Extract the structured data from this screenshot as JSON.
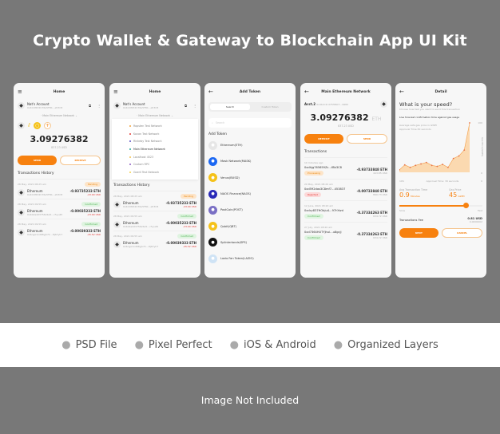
{
  "title": "Crypto Wallet & Gateway to Blockchain App UI Kit",
  "home": {
    "header": "Home",
    "account_name": "Nat's Account",
    "account_address": "0x4C4f432C76e5F8b…e53C8",
    "network": "Main Ethereum Network",
    "balance": "3.09276382",
    "balance_usd": "837.23 USD",
    "send": "SEND",
    "receive": "RECEIVE",
    "history_title": "Transactions History",
    "transactions": [
      {
        "date": "28 May, 2021 08:25 am",
        "status": "Pending",
        "name": "Ethereum",
        "address": "0x4C4f432C76e5F8b…e53C8",
        "amount": "-0.93735233 ETH",
        "usd": "-43.90 USD"
      },
      {
        "date": "28 May, 2021 09:55 am",
        "status": "Confirmed",
        "name": "Ethereum",
        "address": "0x4b2a4d375624a5…c5yu45",
        "amount": "-0.00035233 ETH",
        "usd": "-23.90 USD"
      },
      {
        "date": "28 May, 2021 09:55 am",
        "status": "Confirmed",
        "name": "Ethereum",
        "address": "0x6ngx1nd68yjk7k…HJ67yh7",
        "amount": "-0.00039333 ETH",
        "usd": "-45.52 USD"
      }
    ]
  },
  "networks": [
    {
      "label": "Ropsten Test Network",
      "color": "#f2a33a"
    },
    {
      "label": "Kovan Test Network",
      "color": "#e53935"
    },
    {
      "label": "Rinkeby Test Network",
      "color": "#5c4fc4"
    },
    {
      "label": "Main Ethereum Network",
      "color": "#26a69a"
    },
    {
      "label": "Localhost 4523",
      "color": "#f2c14e"
    },
    {
      "label": "Custom RPC",
      "color": "#8e5cc4"
    },
    {
      "label": "Goerli Test Network",
      "color": "#f5d34a"
    }
  ],
  "add_token": {
    "header": "Add Token",
    "tab_search": "Search",
    "tab_custom": "Custom Token",
    "search_placeholder": "Search",
    "section": "Add Token",
    "tokens": [
      {
        "label": "Ethereum(ETH)",
        "color": "#e6e6e6",
        "icon": "ethereum-icon"
      },
      {
        "label": "Mask Network(MASK)",
        "color": "#1c68f3",
        "icon": "mask-icon"
      },
      {
        "label": "Venus(BUSD)",
        "color": "#f5c21a",
        "icon": "venus-icon"
      },
      {
        "label": "NAOS Finance(NAOS)",
        "color": "#2a2ab8",
        "icon": "naos-icon"
      },
      {
        "label": "PostCoin(POST)",
        "color": "#7a6fc4",
        "icon": "postcoin-icon"
      },
      {
        "label": "Qubit(QBT)",
        "color": "#f5c21a",
        "icon": "qubit-icon"
      },
      {
        "label": "Splinterlands(SPS)",
        "color": "#111111",
        "icon": "splinterlands-icon"
      },
      {
        "label": "Lazio Fan Token(LAZIO)",
        "color": "#cfe3f5",
        "icon": "lazio-icon"
      }
    ]
  },
  "network_screen": {
    "header": "Main Ethereum Network",
    "account": "Acct.2",
    "address": "0x4b2c4cd75f9607…9980",
    "balance": "3.09276382",
    "unit": "ETH",
    "balance_usd": "837.23 USD",
    "deposit": "DEPOSIT",
    "send": "SEND",
    "section": "Transactions",
    "transactions": [
      {
        "date": "10 minutes ago",
        "hash": "0xdhjg765659Zc…f8b3C8",
        "status": "Processing",
        "amount": "-0.93733848 ETH",
        "usd": "443.85 USD"
      },
      {
        "date": "20 May, 2021 08:20 am",
        "hash": "0xd592das3C8mf7…453837",
        "status": "Rejected",
        "amount": "-0.00733848 ETH",
        "usd": "890.73 USD"
      },
      {
        "date": "12 June, 2021 08:20 am",
        "hash": "0xdcy837HObju4…97hYwd",
        "status": "Confirmed",
        "amount": "-0.37334263 ETH",
        "usd": "634.72 USD"
      },
      {
        "date": "27 July, 2021 08:20 am",
        "hash": "0xd7364HUTYjhui…u8gcjj",
        "status": "Confirmed",
        "amount": "-0.37334263 ETH",
        "usd": "634.72 USD"
      }
    ]
  },
  "detail": {
    "header": "Detail",
    "title": "What is your speed?",
    "subtitle": "Choose how fast you want to send this transaction",
    "chart_title": "Live forecast confirmation time against gas usage",
    "chart_note1": "Average safe gas price in GWEI",
    "chart_note2": "Approval Time:30 seconds",
    "y_axis": "Gas Price(GWEI)",
    "y_max": "100",
    "y_min": "0",
    "x_left": "10S",
    "x_mid": "Approval Time: 30 seconds",
    "x_right": "0",
    "gas_points": [
      5,
      15,
      10,
      14,
      17,
      20,
      14,
      12,
      16,
      10,
      28,
      33,
      45,
      100
    ],
    "avg_label": "Avg Transaction Time",
    "avg_value": "0.9",
    "avg_unit": "Minutes",
    "gas_label": "Gas Price",
    "gas_value": "45",
    "gas_unit": "GWEI",
    "speed_level": 0.8,
    "slow": "Slow",
    "fast": "Fast",
    "fee_label": "Transactions Fee",
    "fee_usd": "0.81 USD",
    "fee_eth": "0.0000002",
    "next": "NEXT",
    "cancel": "CANCEL"
  },
  "features": [
    "PSD File",
    "Pixel Perfect",
    "iOS & Android",
    "Organized Layers"
  ],
  "footer": "Image Not Included",
  "colors": {
    "accent": "#f7810f",
    "background": "#787878"
  }
}
